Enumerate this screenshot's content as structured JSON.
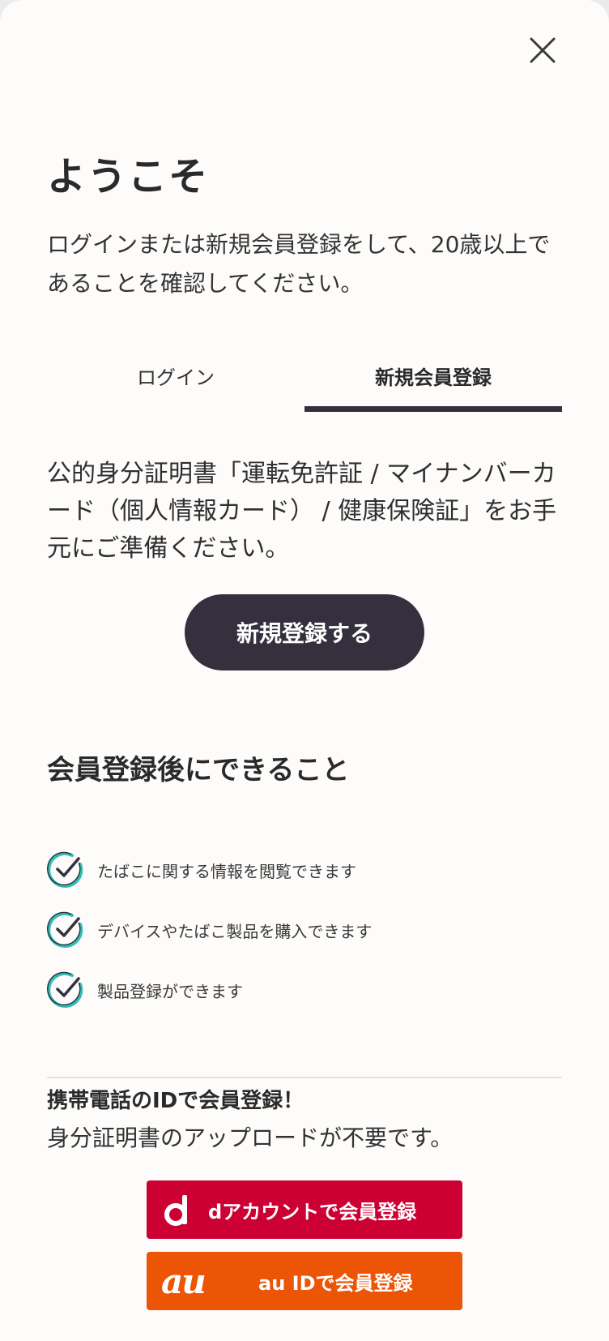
{
  "modal": {
    "title": "ようこそ",
    "intro": "ログインまたは新規会員登録をして、20歳以上であることを確認してください。"
  },
  "tabs": [
    {
      "label": "ログイン",
      "active": false
    },
    {
      "label": "新規会員登録",
      "active": true
    }
  ],
  "register": {
    "docs_note": "公的身分証明書「運転免許証 / マイナンバーカード（個人情報カード） / 健康保険証」をお手元にご準備ください。",
    "button_label": "新規登録する"
  },
  "benefits": {
    "title": "会員登録後にできること",
    "items": [
      "たばこに関する情報を閲覧できます",
      "デバイスやたばこ製品を購入できます",
      "製品登録ができます"
    ]
  },
  "mobile": {
    "title": "携帯電話のIDで会員登録！",
    "description": "身分証明書のアップロードが不要です。",
    "docomo_label": "dアカウントで会員登録",
    "docomo_logo_text": "d",
    "au_label": "au IDで会員登録",
    "au_logo_text": "au"
  },
  "colors": {
    "primary": "#34303d",
    "docomo": "#cc0033",
    "au": "#eb5505",
    "check_teal": "#2fbfb6"
  },
  "icons": {
    "close": "close-icon",
    "check": "check-circle-icon"
  }
}
